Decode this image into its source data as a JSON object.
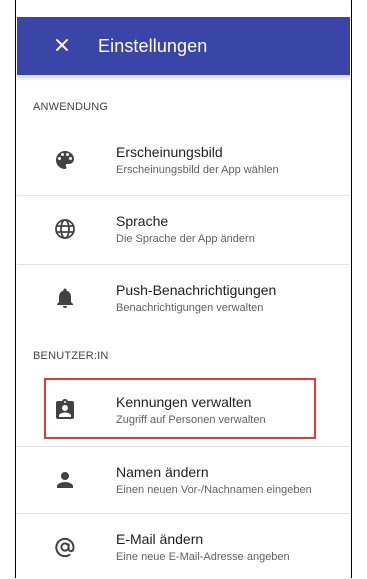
{
  "header": {
    "title": "Einstellungen",
    "close_icon": "close-icon",
    "background": "#3a45a8"
  },
  "sections": [
    {
      "heading": "ANWENDUNG",
      "items": [
        {
          "label": "Erscheinungsbild",
          "sublabel": "Erscheinungsbild der App wählen",
          "icon": "palette-icon"
        },
        {
          "label": "Sprache",
          "sublabel": "Die Sprache der App ändern",
          "icon": "globe-icon"
        },
        {
          "label": "Push-Benachrichtigungen",
          "sublabel": "Benachrichtigungen verwalten",
          "icon": "bell-icon"
        }
      ]
    },
    {
      "heading": "BENUTZER:IN",
      "items": [
        {
          "label": "Kennungen verwalten",
          "sublabel": "Zugriff auf Personen verwalten",
          "icon": "id-badge-icon",
          "highlighted": true
        },
        {
          "label": "Namen ändern",
          "sublabel": "Einen neuen Vor-/Nachnamen eingeben",
          "icon": "person-icon"
        },
        {
          "label": "E-Mail ändern",
          "sublabel": "Eine neue E-Mail-Adresse angeben",
          "icon": "at-sign-icon"
        }
      ]
    }
  ],
  "highlight_color": "#e53935"
}
